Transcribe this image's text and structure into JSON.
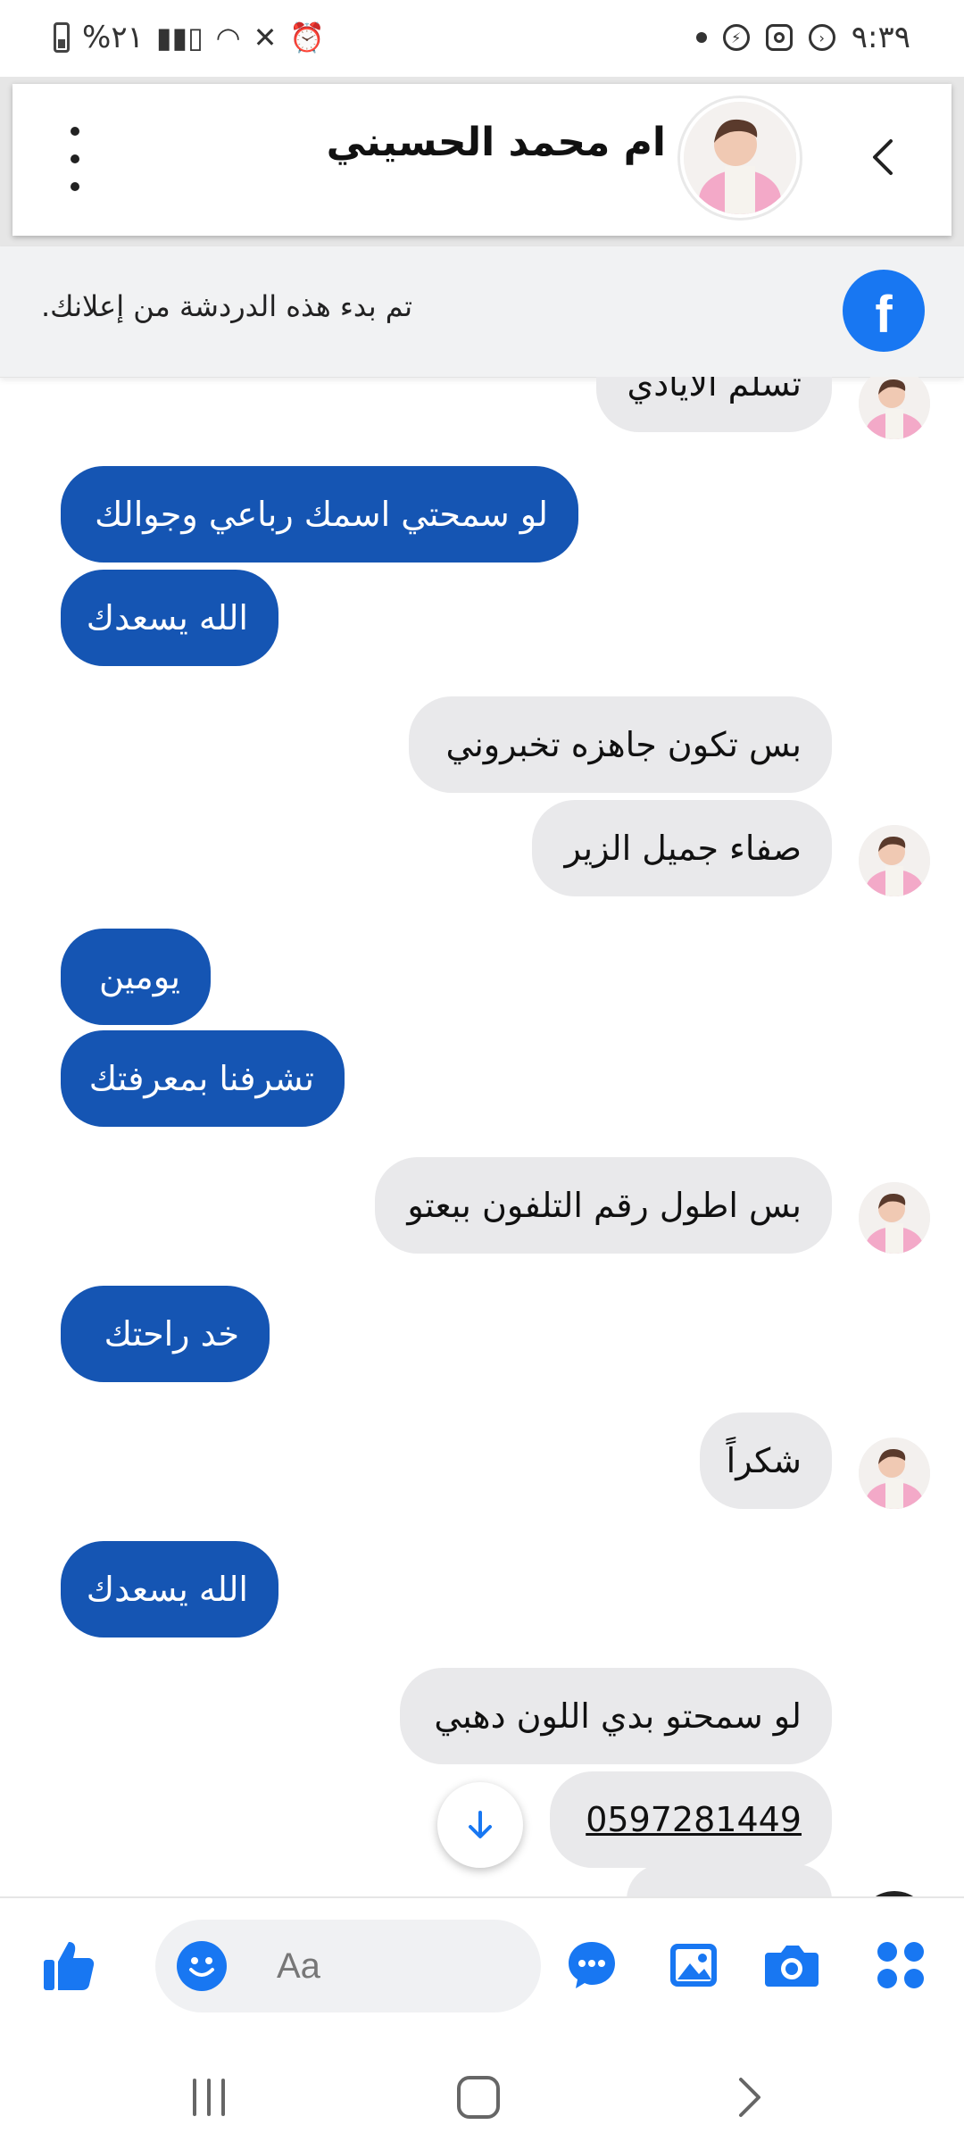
{
  "status_bar": {
    "battery": "%٢١",
    "time": "٩:٣٩"
  },
  "header": {
    "contact_name": "ام محمد الحسيني"
  },
  "ad_banner": {
    "text": ".تم بدء هذه الدردشة من إعلانك"
  },
  "messages": [
    {
      "direction": "in",
      "text": "تسلم الايادي"
    },
    {
      "direction": "out",
      "text": "لو سمحتي اسمك رباعي وجوالك"
    },
    {
      "direction": "out",
      "text": "الله يسعدك"
    },
    {
      "direction": "in",
      "text": "بس تكون جاهزه تخبروني"
    },
    {
      "direction": "in",
      "text": "صفاء جميل الزير"
    },
    {
      "direction": "out",
      "text": "يومين"
    },
    {
      "direction": "out",
      "text": "تشرفنا بمعرفتك"
    },
    {
      "direction": "in",
      "text": "بس اطول رقم التلفون ببعتو"
    },
    {
      "direction": "out",
      "text": "خد راحتك"
    },
    {
      "direction": "in",
      "text": "شكراً"
    },
    {
      "direction": "out",
      "text": "الله يسعدك"
    },
    {
      "direction": "in",
      "text": "لو سمحتو بدي اللون دهبي"
    },
    {
      "direction": "in",
      "text": "0597281449"
    }
  ],
  "composer": {
    "placeholder": "Aa"
  },
  "colors": {
    "outgoing_bubble": "#1555b3",
    "incoming_bubble": "#e9e9eb",
    "messenger_blue": "#1877f2"
  }
}
